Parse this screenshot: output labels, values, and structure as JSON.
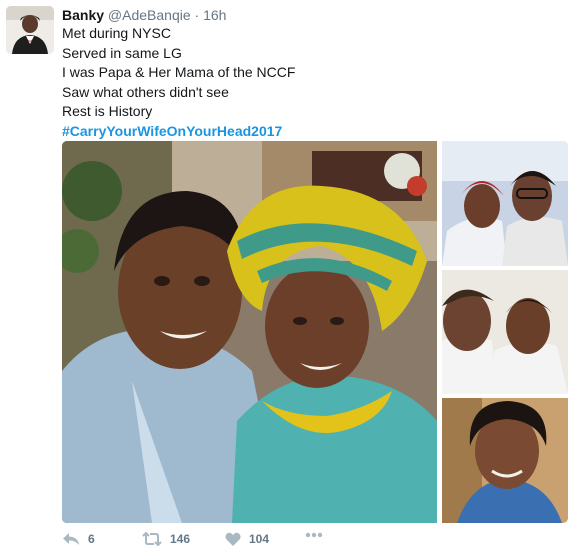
{
  "user": {
    "display_name": "Banky",
    "handle": "@AdeBanqie",
    "time": "16h"
  },
  "tweet": {
    "lines": [
      "Met during NYSC",
      "Served in same LG",
      "I was Papa & Her Mama of the NCCF",
      "Saw what others didn't see",
      "Rest is History"
    ],
    "hashtag": "#CarryYourWifeOnYourHead2017"
  },
  "media": {
    "photos": [
      "main-couple-photo",
      "couple-thumb-1",
      "couple-thumb-2",
      "woman-thumb-3"
    ]
  },
  "actions": {
    "reply_icon": "reply-icon",
    "reply_count": "6",
    "retweet_icon": "retweet-icon",
    "retweet_count": "146",
    "like_icon": "heart-icon",
    "like_count": "104",
    "more_icon": "more-icon"
  },
  "colors": {
    "text": "#14171a",
    "secondary": "#657786",
    "link": "#1b95e0"
  }
}
